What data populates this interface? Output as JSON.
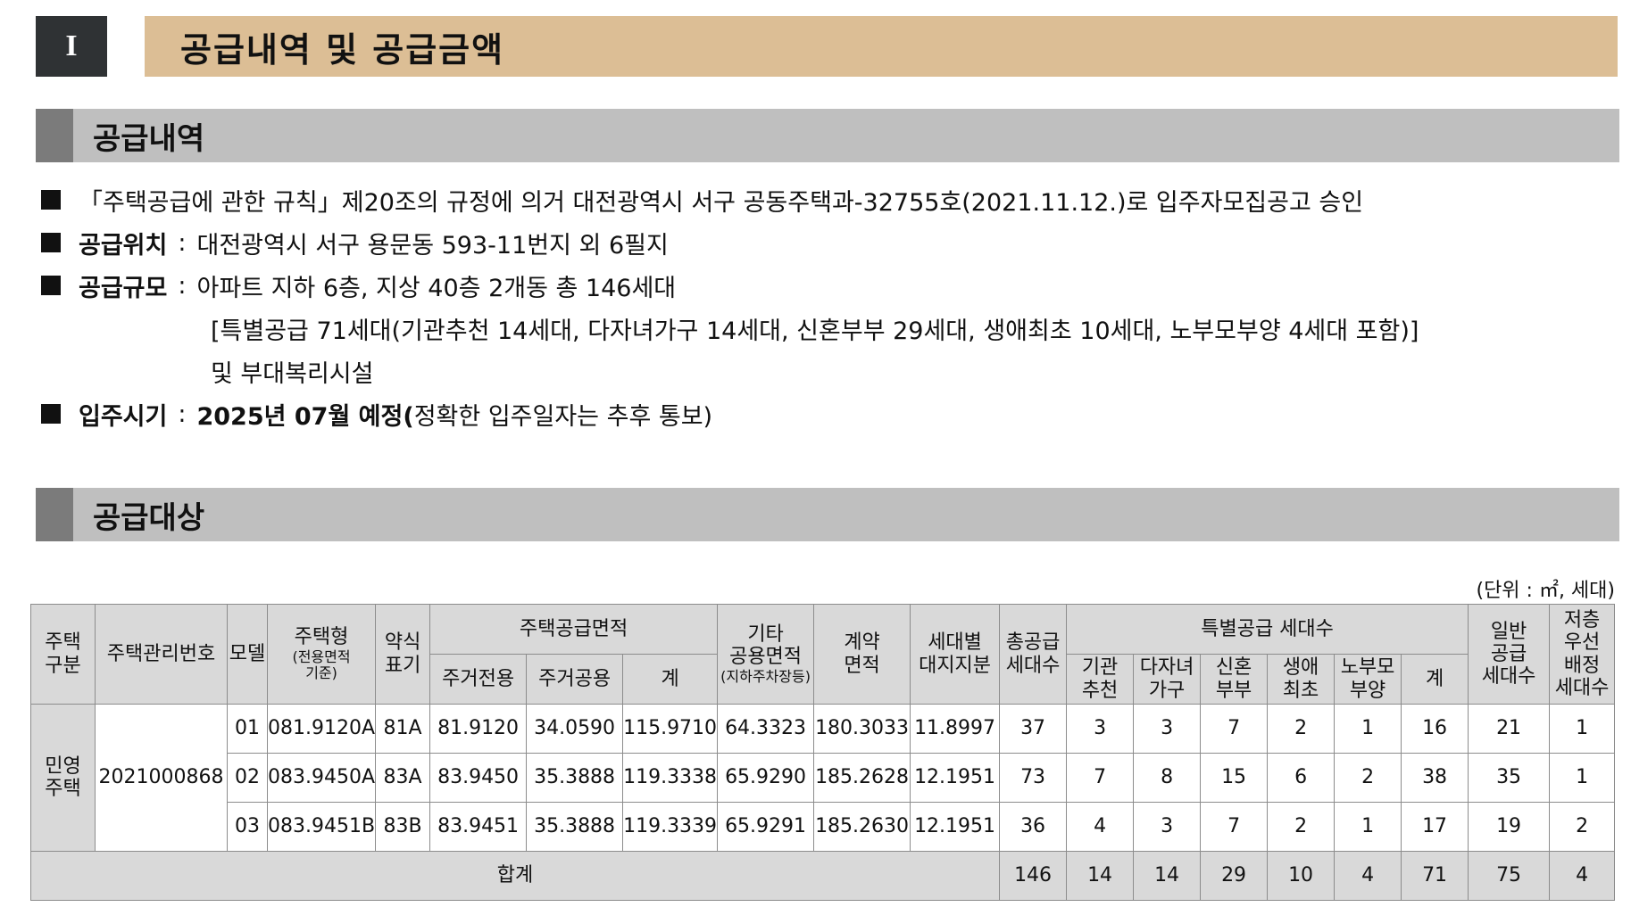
{
  "title": {
    "badge": "I",
    "text": "공급내역 및 공급금액"
  },
  "sections": {
    "supply_details": "공급내역",
    "supply_target": "공급대상"
  },
  "info": {
    "approval": "「주택공급에 관한 규칙」제20조의 규정에 의거 대전광역시 서구 공동주택과-32755호(2021.11.12.)로 입주자모집공고 승인",
    "location_key": "공급위치",
    "location_value": "대전광역시 서구 용문동 593-11번지 외 6필지",
    "scale_key": "공급규모",
    "scale_value": "아파트 지하 6층, 지상 40층 2개동 총 146세대",
    "scale_line2": "[특별공급 71세대(기관추천 14세대, 다자녀가구 14세대, 신혼부부 29세대, 생애최초 10세대, 노부모부양 4세대 포함)]",
    "scale_line3": "및 부대복리시설",
    "movein_key": "입주시기",
    "movein_bold": "2025년 07월 예정(",
    "movein_rest": "정확한 입주일자는 추후 통보)",
    "colon": ":"
  },
  "unit_note": "(단위 : ㎡, 세대)",
  "table": {
    "headers": {
      "housing_type_cat": "주택\n구분",
      "mgmt_no": "주택관리번호",
      "model": "모델",
      "housing_type": "주택형",
      "housing_type_sub": "(전용면적\n기준)",
      "abbrev": "약식\n표기",
      "supply_area": "주택공급면적",
      "exclusive": "주거전용",
      "common": "주거공용",
      "sum": "계",
      "other_common": "기타\n공용면적",
      "other_common_sub": "(지하주차장등)",
      "contract_area": "계약\n면적",
      "land_share": "세대별\n대지지분",
      "total_units": "총공급\n세대수",
      "special_units": "특별공급 세대수",
      "inst": "기관\n추천",
      "multi": "다자녀\n가구",
      "newlywed": "신혼\n부부",
      "first": "생애\n최초",
      "elderly": "노부모\n부양",
      "special_sum": "계",
      "general": "일반\n공급\n세대수",
      "low_floor": "저층\n우선\n배정\n세대수"
    },
    "category": "민영\n주택",
    "mgmt_number": "2021000868",
    "rows": [
      {
        "model": "01",
        "type": "081.9120A",
        "abbr": "81A",
        "excl": "81.9120",
        "comm": "34.0590",
        "sum": "115.9710",
        "other": "64.3323",
        "contract": "180.3033",
        "land": "11.8997",
        "total": "37",
        "inst": "3",
        "multi": "3",
        "newly": "7",
        "first": "2",
        "elder": "1",
        "ssum": "16",
        "general": "21",
        "low": "1"
      },
      {
        "model": "02",
        "type": "083.9450A",
        "abbr": "83A",
        "excl": "83.9450",
        "comm": "35.3888",
        "sum": "119.3338",
        "other": "65.9290",
        "contract": "185.2628",
        "land": "12.1951",
        "total": "73",
        "inst": "7",
        "multi": "8",
        "newly": "15",
        "first": "6",
        "elder": "2",
        "ssum": "38",
        "general": "35",
        "low": "1"
      },
      {
        "model": "03",
        "type": "083.9451B",
        "abbr": "83B",
        "excl": "83.9451",
        "comm": "35.3888",
        "sum": "119.3339",
        "other": "65.9291",
        "contract": "185.2630",
        "land": "12.1951",
        "total": "36",
        "inst": "4",
        "multi": "3",
        "newly": "7",
        "first": "2",
        "elder": "1",
        "ssum": "17",
        "general": "19",
        "low": "2"
      }
    ],
    "total": {
      "label": "합계",
      "total": "146",
      "inst": "14",
      "multi": "14",
      "newly": "29",
      "first": "10",
      "elder": "4",
      "ssum": "71",
      "general": "75",
      "low": "4"
    }
  }
}
